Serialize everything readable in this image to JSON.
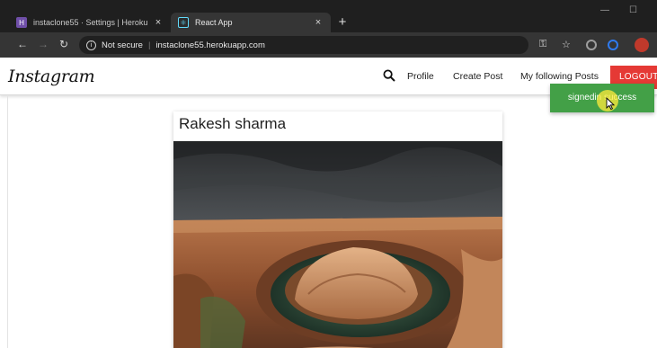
{
  "browser": {
    "tabs": [
      {
        "title": "instaclone55 · Settings | Heroku",
        "close": "×"
      },
      {
        "title": "React App",
        "close": "×"
      }
    ],
    "new_tab": "+",
    "security_label": "Not secure",
    "url": "instaclone55.herokuapp.com",
    "info_glyph": "i",
    "separator": "|"
  },
  "nav": {
    "brand": "Instagram",
    "links": [
      "Profile",
      "Create Post",
      "My following Posts"
    ],
    "logout": "LOGOUT"
  },
  "post": {
    "author": "Rakesh sharma"
  },
  "toast": {
    "message": "signedin success"
  },
  "colors": {
    "logout": "#e53935",
    "toast": "#43a047"
  },
  "icons": [
    "search-icon",
    "back-arrow-icon",
    "forward-arrow-icon",
    "reload-icon",
    "key-icon",
    "star-icon",
    "extension-icon",
    "profile-avatar-icon"
  ]
}
